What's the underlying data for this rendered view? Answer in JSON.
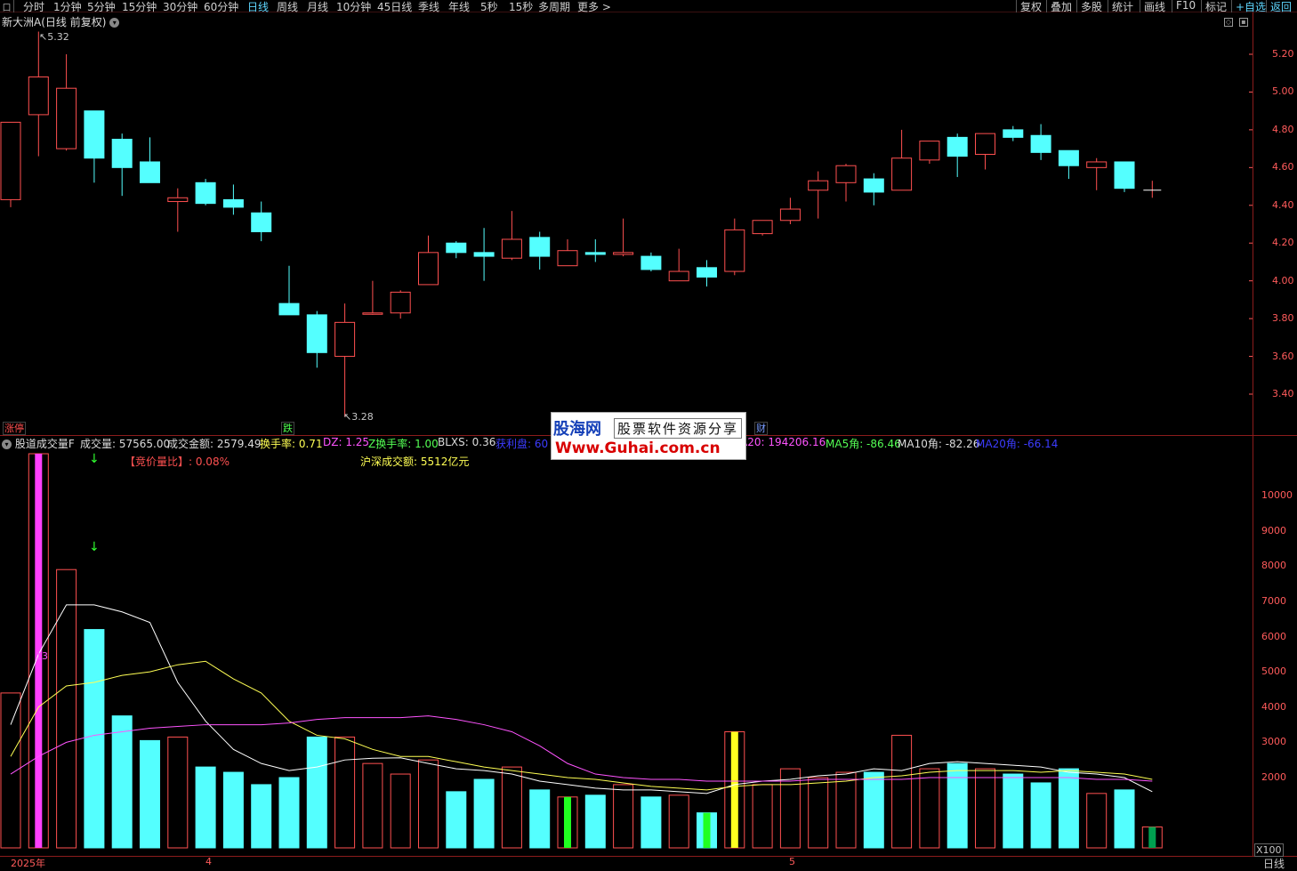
{
  "toolbar": {
    "left_square": "口",
    "tabs": [
      {
        "label": "分时",
        "active": false
      },
      {
        "label": "1分钟",
        "active": false
      },
      {
        "label": "5分钟",
        "active": false
      },
      {
        "label": "15分钟",
        "active": false
      },
      {
        "label": "30分钟",
        "active": false
      },
      {
        "label": "60分钟",
        "active": false
      },
      {
        "label": "日线",
        "active": true
      },
      {
        "label": "周线",
        "active": false
      },
      {
        "label": "月线",
        "active": false
      },
      {
        "label": "10分钟",
        "active": false
      },
      {
        "label": "45日线",
        "active": false
      },
      {
        "label": "季线",
        "active": false
      },
      {
        "label": "年线",
        "active": false
      },
      {
        "label": "5秒",
        "active": false
      },
      {
        "label": "15秒",
        "active": false
      },
      {
        "label": "多周期",
        "active": false
      },
      {
        "label": "更多 >",
        "active": false
      }
    ],
    "right_buttons": [
      "复权",
      "叠加",
      "多股",
      "统计",
      "画线",
      "F10",
      "标记",
      "+自选",
      "返回"
    ]
  },
  "chart_title": "新大洲A(日线 前复权)",
  "title_icon": "chevron-down-icon",
  "price_axis": {
    "ticks": [
      "5.20",
      "5.00",
      "4.80",
      "4.60",
      "4.40",
      "4.20",
      "4.00",
      "3.80",
      "3.60",
      "3.40"
    ],
    "color": "#ff5b5b"
  },
  "price_annotations": {
    "high": "5.32",
    "low": "3.28"
  },
  "badges": {
    "zhangting": "涨停",
    "die": "跌",
    "cai": "财"
  },
  "indicator": {
    "name": "股道成交量F",
    "items": [
      {
        "label": "成交量: 57565.00",
        "color": "#dcdcdc"
      },
      {
        "label": "成交金额: 2579.49",
        "color": "#dcdcdc"
      },
      {
        "label": "换手率: 0.71",
        "color": "#ffff54"
      },
      {
        "label": "DZ: 1.25",
        "color": "#ff54ff"
      },
      {
        "label": "Z换手率: 1.00",
        "color": "#54ff54"
      },
      {
        "label": "BLXS: 0.36",
        "color": "#dcdcdc"
      },
      {
        "label": "获利盘: 60",
        "color": "#3c3cff"
      },
      {
        "label": "A20: 194206.16",
        "color": "#ff54ff"
      },
      {
        "label": "MA5角: -86.46",
        "color": "#54ff54"
      },
      {
        "label": "MA10角: -82.26",
        "color": "#dcdcdc"
      },
      {
        "label": "MA20角: -66.14",
        "color": "#3c3cff"
      }
    ],
    "auction": "【竞价量比】: 0.08%",
    "market_turnover": "沪深成交额: 5512亿元",
    "marker_13": "13",
    "multiplier": "X100"
  },
  "volume_axis": {
    "ticks": [
      "10000",
      "9000",
      "8000",
      "7000",
      "6000",
      "5000",
      "4000",
      "3000",
      "2000"
    ]
  },
  "x_axis": {
    "labels": [
      "2025年",
      "4",
      "5"
    ],
    "period": "日线"
  },
  "watermark": {
    "line1": "股海网",
    "line2": "股票软件资源分享",
    "line3": "Www.Guhai.com.cn"
  },
  "chart_data": {
    "type": "candlestick",
    "title": "新大洲A(日线 前复权)",
    "ylim": [
      3.2,
      5.3
    ],
    "candles": [
      {
        "o": 4.43,
        "h": 4.84,
        "l": 4.39,
        "c": 4.84
      },
      {
        "o": 4.88,
        "h": 5.32,
        "l": 4.66,
        "c": 5.08
      },
      {
        "o": 4.7,
        "h": 5.2,
        "l": 4.69,
        "c": 5.02
      },
      {
        "o": 4.9,
        "h": 4.9,
        "l": 4.52,
        "c": 4.65
      },
      {
        "o": 4.75,
        "h": 4.78,
        "l": 4.45,
        "c": 4.6
      },
      {
        "o": 4.63,
        "h": 4.76,
        "l": 4.52,
        "c": 4.52
      },
      {
        "o": 4.42,
        "h": 4.49,
        "l": 4.26,
        "c": 4.44
      },
      {
        "o": 4.52,
        "h": 4.54,
        "l": 4.4,
        "c": 4.41
      },
      {
        "o": 4.43,
        "h": 4.51,
        "l": 4.35,
        "c": 4.39
      },
      {
        "o": 4.36,
        "h": 4.42,
        "l": 4.21,
        "c": 4.26
      },
      {
        "o": 3.88,
        "h": 4.08,
        "l": 3.82,
        "c": 3.82
      },
      {
        "o": 3.82,
        "h": 3.84,
        "l": 3.54,
        "c": 3.62
      },
      {
        "o": 3.6,
        "h": 3.88,
        "l": 3.28,
        "c": 3.78
      },
      {
        "o": 3.83,
        "h": 4.0,
        "l": 3.82,
        "c": 3.83
      },
      {
        "o": 3.83,
        "h": 3.95,
        "l": 3.8,
        "c": 3.94
      },
      {
        "o": 3.98,
        "h": 4.24,
        "l": 3.98,
        "c": 4.15
      },
      {
        "o": 4.2,
        "h": 4.21,
        "l": 4.12,
        "c": 4.15
      },
      {
        "o": 4.15,
        "h": 4.28,
        "l": 4.0,
        "c": 4.13
      },
      {
        "o": 4.12,
        "h": 4.37,
        "l": 4.11,
        "c": 4.22
      },
      {
        "o": 4.23,
        "h": 4.26,
        "l": 4.06,
        "c": 4.13
      },
      {
        "o": 4.08,
        "h": 4.22,
        "l": 4.08,
        "c": 4.16
      },
      {
        "o": 4.15,
        "h": 4.22,
        "l": 4.1,
        "c": 4.14
      },
      {
        "o": 4.14,
        "h": 4.33,
        "l": 4.13,
        "c": 4.15
      },
      {
        "o": 4.13,
        "h": 4.15,
        "l": 4.05,
        "c": 4.06
      },
      {
        "o": 4.0,
        "h": 4.17,
        "l": 4.0,
        "c": 4.05
      },
      {
        "o": 4.07,
        "h": 4.11,
        "l": 3.97,
        "c": 4.02
      },
      {
        "o": 4.05,
        "h": 4.33,
        "l": 4.03,
        "c": 4.27
      },
      {
        "o": 4.25,
        "h": 4.32,
        "l": 4.24,
        "c": 4.32
      },
      {
        "o": 4.32,
        "h": 4.44,
        "l": 4.3,
        "c": 4.38
      },
      {
        "o": 4.48,
        "h": 4.58,
        "l": 4.33,
        "c": 4.53
      },
      {
        "o": 4.52,
        "h": 4.62,
        "l": 4.42,
        "c": 4.61
      },
      {
        "o": 4.54,
        "h": 4.57,
        "l": 4.4,
        "c": 4.47
      },
      {
        "o": 4.48,
        "h": 4.8,
        "l": 4.48,
        "c": 4.65
      },
      {
        "o": 4.64,
        "h": 4.74,
        "l": 4.62,
        "c": 4.74
      },
      {
        "o": 4.76,
        "h": 4.78,
        "l": 4.55,
        "c": 4.66
      },
      {
        "o": 4.67,
        "h": 4.78,
        "l": 4.59,
        "c": 4.78
      },
      {
        "o": 4.8,
        "h": 4.82,
        "l": 4.74,
        "c": 4.76
      },
      {
        "o": 4.77,
        "h": 4.83,
        "l": 4.64,
        "c": 4.68
      },
      {
        "o": 4.69,
        "h": 4.69,
        "l": 4.54,
        "c": 4.61
      },
      {
        "o": 4.6,
        "h": 4.65,
        "l": 4.48,
        "c": 4.63
      },
      {
        "o": 4.63,
        "h": 4.63,
        "l": 4.47,
        "c": 4.49
      },
      {
        "o": 4.48,
        "h": 4.53,
        "l": 4.44,
        "c": 4.48
      }
    ],
    "volume": {
      "ylim": [
        0,
        11000
      ],
      "values": [
        4400,
        11600,
        7900,
        6200,
        3750,
        3050,
        3150,
        2300,
        2150,
        1800,
        2000,
        3150,
        3150,
        2400,
        2100,
        2500,
        1600,
        1950,
        2300,
        1650,
        1450,
        1500,
        1800,
        1450,
        1500,
        1000,
        3300,
        1800,
        2250,
        2000,
        2150,
        2150,
        3200,
        2250,
        2400,
        2250,
        2100,
        1850,
        2250,
        1550,
        1650,
        600
      ],
      "series": [
        {
          "name": "MA5",
          "color": "#ffffff",
          "values": [
            3500,
            5500,
            6900,
            6900,
            6700,
            6400,
            4700,
            3600,
            2800,
            2400,
            2200,
            2300,
            2500,
            2550,
            2560,
            2400,
            2250,
            2200,
            2100,
            1900,
            1800,
            1700,
            1650,
            1650,
            1600,
            1550,
            1800,
            1900,
            1950,
            2050,
            2100,
            2250,
            2200,
            2400,
            2450,
            2400,
            2350,
            2300,
            2150,
            2100,
            2000,
            1600
          ]
        },
        {
          "name": "MA10",
          "color": "#ffff54",
          "values": [
            2600,
            4000,
            4600,
            4700,
            4900,
            5000,
            5200,
            5300,
            4800,
            4400,
            3600,
            3200,
            3100,
            2800,
            2600,
            2600,
            2450,
            2300,
            2200,
            2100,
            2000,
            1950,
            1850,
            1750,
            1700,
            1650,
            1750,
            1800,
            1800,
            1850,
            1900,
            2000,
            2050,
            2150,
            2200,
            2200,
            2200,
            2150,
            2200,
            2150,
            2100,
            1950
          ]
        },
        {
          "name": "MA20",
          "color": "#ff54ff",
          "values": [
            2100,
            2600,
            3000,
            3200,
            3300,
            3400,
            3450,
            3500,
            3500,
            3500,
            3550,
            3650,
            3700,
            3700,
            3700,
            3750,
            3650,
            3500,
            3300,
            2900,
            2400,
            2100,
            2000,
            1950,
            1950,
            1900,
            1900,
            1900,
            1900,
            1950,
            1950,
            1950,
            1950,
            2000,
            2000,
            2000,
            2000,
            2000,
            2000,
            1950,
            1950,
            1900
          ]
        }
      ]
    }
  }
}
